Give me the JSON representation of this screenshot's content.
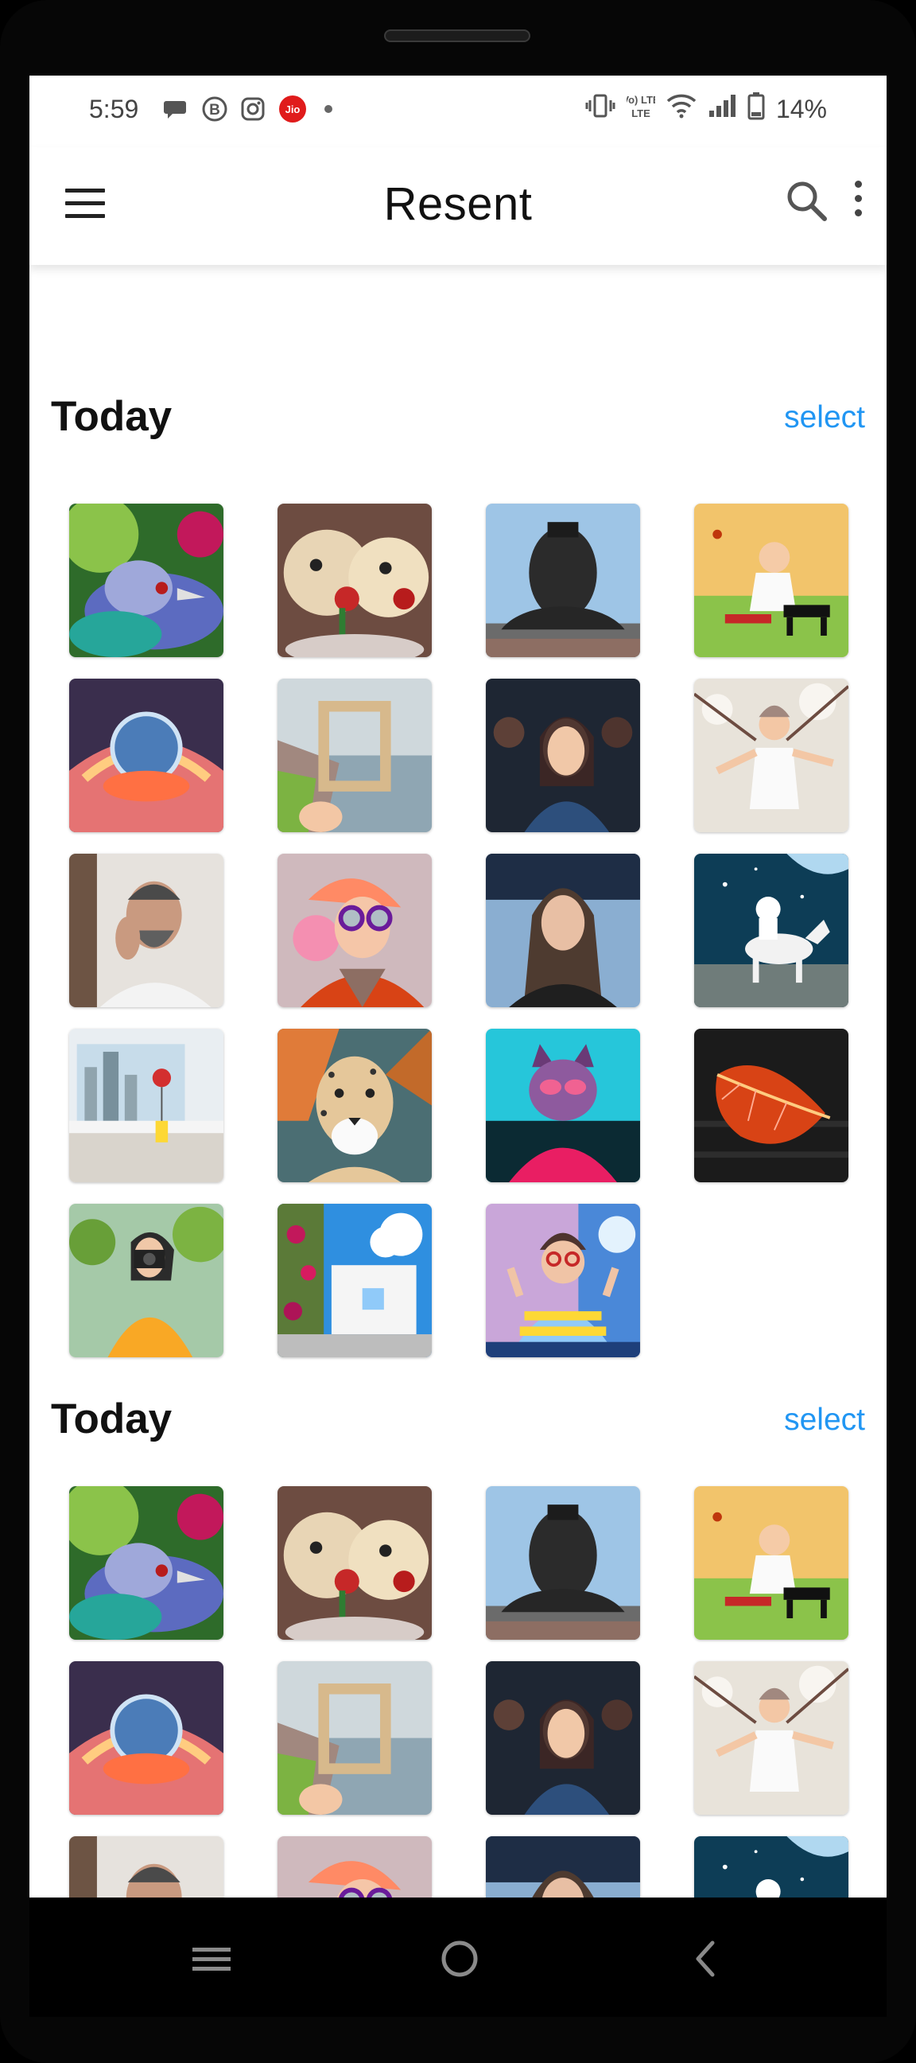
{
  "status_bar": {
    "time": "5:59",
    "battery": "14%",
    "left_icons": [
      "chat-icon",
      "b-badge-icon",
      "instagram-icon",
      "jio-icon",
      "dot-icon"
    ],
    "jio_label": "Jio",
    "b_label": "B",
    "volte_label": "Vo) LTE",
    "right_icons": [
      "vibrate-icon",
      "volte-icon",
      "wifi-icon",
      "signal-icon",
      "battery-icon"
    ]
  },
  "app_bar": {
    "title": "Resent",
    "menu_icon": "hamburger-menu-icon",
    "search_icon": "search-icon",
    "more_icon": "more-vert-icon"
  },
  "sections": [
    {
      "title": "Today",
      "select_label": "select",
      "photos": [
        "peacock-bird",
        "teddy-bears-roses",
        "adiyogi-statue",
        "baby-piano",
        "glass-sphere-flower",
        "frame-cliff-ocean",
        "woman-crowd",
        "woman-blossoms",
        "bearded-man",
        "punk-character-goggles",
        "woman-portrait",
        "astronaut-horse",
        "balloon-window-city",
        "cheetah-painting",
        "cat-sunglasses",
        "autumn-leaf",
        "woman-camera",
        "white-house-flowers",
        "girl-peace-sign"
      ]
    },
    {
      "title": "Today",
      "select_label": "select",
      "photos": [
        "peacock-bird",
        "teddy-bears-roses",
        "adiyogi-statue",
        "baby-piano",
        "glass-sphere-flower",
        "frame-cliff-ocean",
        "woman-crowd",
        "woman-blossoms",
        "bearded-man",
        "punk-character-goggles",
        "woman-portrait",
        "astronaut-horse"
      ]
    }
  ],
  "nav_bar": {
    "recents_icon": "recents-icon",
    "home_icon": "home-icon",
    "back_icon": "back-icon"
  },
  "colors": {
    "accent": "#2196F3",
    "title": "#111111",
    "status_text": "#444444",
    "nav_icons": "#8a8a8a"
  }
}
